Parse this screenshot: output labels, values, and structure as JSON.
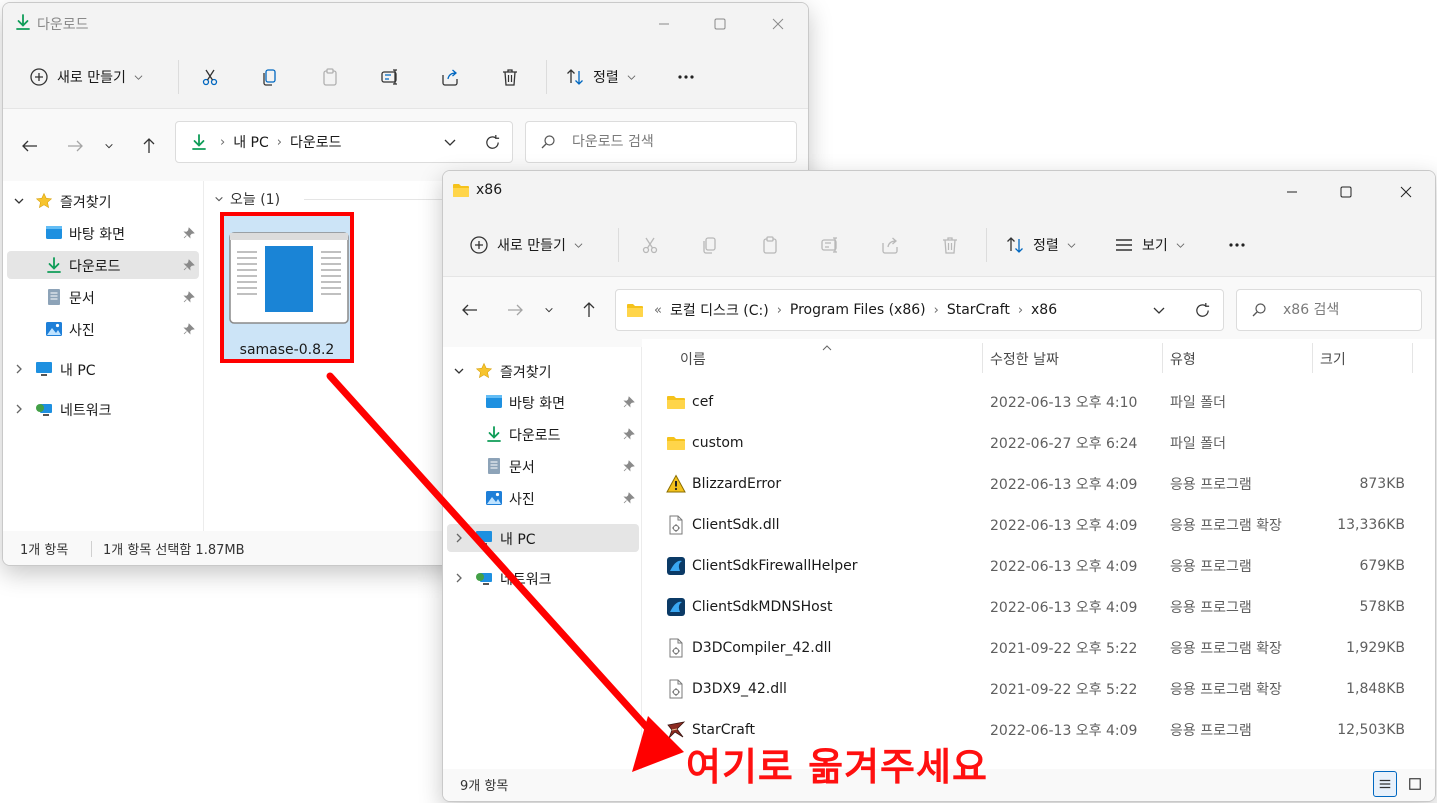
{
  "colors": {
    "accent": "#0067c0",
    "highlight": "#ff0000",
    "folder": "#f5c21b",
    "selected_bg": "#e5e5e5"
  },
  "window_a": {
    "title": "다운로드",
    "toolbar": {
      "new_label": "새로 만들기",
      "sort_label": "정렬"
    },
    "nav": {
      "back_icon": "arrow-left-icon",
      "forward_icon": "arrow-right-icon",
      "up_icon": "arrow-up-icon"
    },
    "address": {
      "segments": [
        "내 PC",
        "다운로드"
      ]
    },
    "search": {
      "placeholder": "다운로드 검색"
    },
    "sidebar": {
      "quick_access": "즐겨찾기",
      "items": [
        {
          "label": "바탕 화면",
          "icon": "desktop-icon",
          "pinned": true
        },
        {
          "label": "다운로드",
          "icon": "download-icon",
          "pinned": true,
          "selected": true
        },
        {
          "label": "문서",
          "icon": "document-icon",
          "pinned": true
        },
        {
          "label": "사진",
          "icon": "pictures-icon",
          "pinned": true
        }
      ],
      "this_pc": "내 PC",
      "network": "네트워크"
    },
    "group": {
      "label": "오늘 (1)"
    },
    "file": {
      "name": "samase-0.8.2"
    },
    "status": {
      "count": "1개 항목",
      "selection": "1개 항목 선택함 1.87MB"
    }
  },
  "window_b": {
    "title": "x86",
    "toolbar": {
      "new_label": "새로 만들기",
      "sort_label": "정렬",
      "view_label": "보기"
    },
    "address": {
      "overflow": "«",
      "segments": [
        "로컬 디스크 (C:)",
        "Program Files (x86)",
        "StarCraft",
        "x86"
      ]
    },
    "search": {
      "placeholder": "x86 검색"
    },
    "sidebar": {
      "quick_access": "즐겨찾기",
      "items": [
        {
          "label": "바탕 화면",
          "icon": "desktop-icon",
          "pinned": true
        },
        {
          "label": "다운로드",
          "icon": "download-icon",
          "pinned": true
        },
        {
          "label": "문서",
          "icon": "document-icon",
          "pinned": true
        },
        {
          "label": "사진",
          "icon": "pictures-icon",
          "pinned": true
        }
      ],
      "this_pc": "내 PC",
      "network": "네트워크"
    },
    "columns": {
      "name": "이름",
      "modified": "수정한 날짜",
      "type": "유형",
      "size": "크기"
    },
    "files": [
      {
        "name": "cef",
        "modified": "2022-06-13 오후 4:10",
        "type": "파일 폴더",
        "size": "",
        "icon": "folder-icon"
      },
      {
        "name": "custom",
        "modified": "2022-06-27 오후 6:24",
        "type": "파일 폴더",
        "size": "",
        "icon": "folder-icon"
      },
      {
        "name": "BlizzardError",
        "modified": "2022-06-13 오후 4:09",
        "type": "응용 프로그램",
        "size": "873KB",
        "icon": "warning-icon"
      },
      {
        "name": "ClientSdk.dll",
        "modified": "2022-06-13 오후 4:09",
        "type": "응용 프로그램 확장",
        "size": "13,336KB",
        "icon": "dll-file-icon"
      },
      {
        "name": "ClientSdkFirewallHelper",
        "modified": "2022-06-13 오후 4:09",
        "type": "응용 프로그램",
        "size": "679KB",
        "icon": "app-icon"
      },
      {
        "name": "ClientSdkMDNSHost",
        "modified": "2022-06-13 오후 4:09",
        "type": "응용 프로그램",
        "size": "578KB",
        "icon": "app-icon"
      },
      {
        "name": "D3DCompiler_42.dll",
        "modified": "2021-09-22 오후 5:22",
        "type": "응용 프로그램 확장",
        "size": "1,929KB",
        "icon": "dll-file-icon"
      },
      {
        "name": "D3DX9_42.dll",
        "modified": "2021-09-22 오후 5:22",
        "type": "응용 프로그램 확장",
        "size": "1,848KB",
        "icon": "dll-file-icon"
      },
      {
        "name": "StarCraft",
        "modified": "2022-06-13 오후 4:09",
        "type": "응용 프로그램",
        "size": "12,503KB",
        "icon": "starcraft-icon"
      }
    ],
    "status": {
      "count": "9개 항목"
    }
  },
  "annotation": {
    "caption": "여기로 옮겨주세요"
  }
}
